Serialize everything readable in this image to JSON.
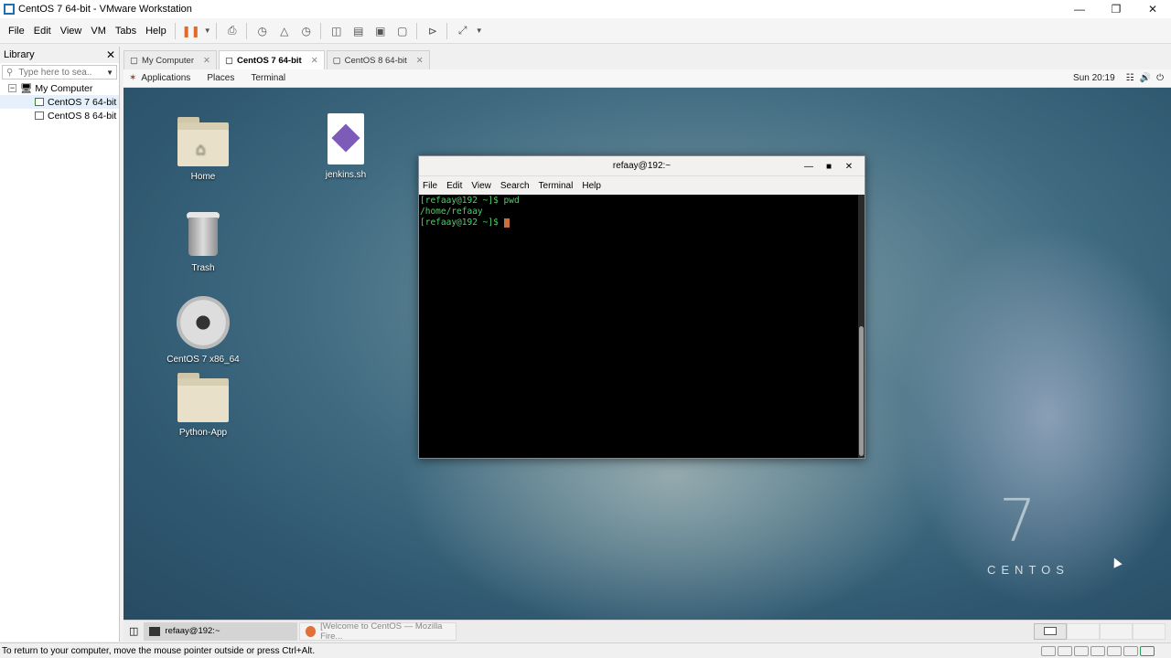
{
  "window": {
    "title": "CentOS 7 64-bit - VMware Workstation"
  },
  "menu": {
    "file": "File",
    "edit": "Edit",
    "view": "View",
    "vm": "VM",
    "tabs": "Tabs",
    "help": "Help"
  },
  "library": {
    "title": "Library",
    "search_placeholder": "Type here to sea...",
    "tree": {
      "root": "My Computer",
      "vm1": "CentOS 7 64-bit",
      "vm2": "CentOS 8 64-bit"
    }
  },
  "tabs": [
    {
      "label": "My Computer",
      "active": false
    },
    {
      "label": "CentOS 7 64-bit",
      "active": true
    },
    {
      "label": "CentOS 8 64-bit",
      "active": false
    }
  ],
  "gnome": {
    "applications": "Applications",
    "places": "Places",
    "terminal": "Terminal",
    "clock": "Sun 20:19"
  },
  "desktop_icons": {
    "home": "Home",
    "jenkins": "jenkins.sh",
    "trash": "Trash",
    "dvd": "CentOS 7 x86_64",
    "python": "Python-App"
  },
  "terminal": {
    "title": "refaay@192:~",
    "menu": {
      "file": "File",
      "edit": "Edit",
      "view": "View",
      "search": "Search",
      "terminal": "Terminal",
      "help": "Help"
    },
    "lines": {
      "l1": "[refaay@192 ~]$ pwd",
      "l2": "/home/refaay",
      "l3": "[refaay@192 ~]$ "
    }
  },
  "branding": {
    "number": "7",
    "word": "CENTOS"
  },
  "taskbar": {
    "task1": "refaay@192:~",
    "task2": "[Welcome to CentOS — Mozilla Fire..."
  },
  "status": {
    "message": "To return to your computer, move the mouse pointer outside or press Ctrl+Alt."
  },
  "colors": {
    "accent": "#1f6fb5",
    "terminal_text": "#4fd26a",
    "cursor": "#c8703c"
  }
}
